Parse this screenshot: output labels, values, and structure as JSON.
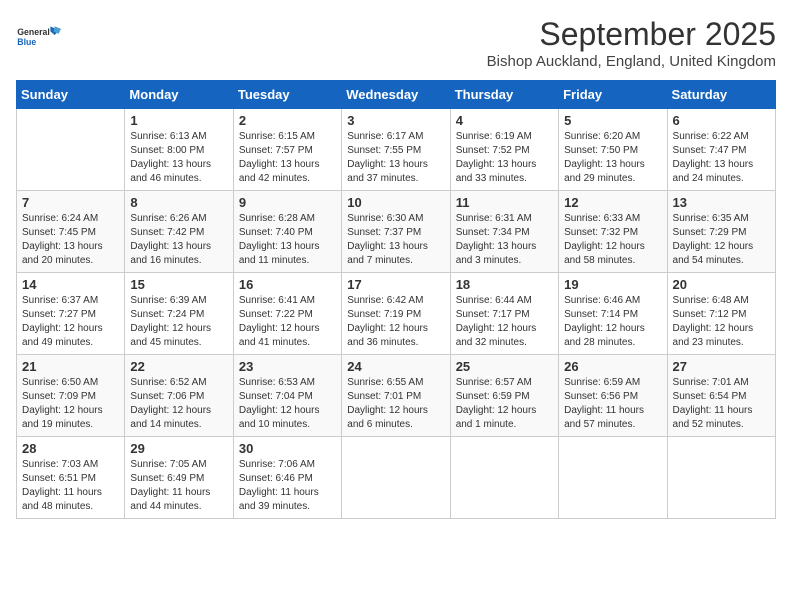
{
  "header": {
    "logo_general": "General",
    "logo_blue": "Blue",
    "month_title": "September 2025",
    "location": "Bishop Auckland, England, United Kingdom"
  },
  "calendar": {
    "days_of_week": [
      "Sunday",
      "Monday",
      "Tuesday",
      "Wednesday",
      "Thursday",
      "Friday",
      "Saturday"
    ],
    "weeks": [
      [
        {
          "day": "",
          "sunrise": "",
          "sunset": "",
          "daylight": ""
        },
        {
          "day": "1",
          "sunrise": "Sunrise: 6:13 AM",
          "sunset": "Sunset: 8:00 PM",
          "daylight": "Daylight: 13 hours and 46 minutes."
        },
        {
          "day": "2",
          "sunrise": "Sunrise: 6:15 AM",
          "sunset": "Sunset: 7:57 PM",
          "daylight": "Daylight: 13 hours and 42 minutes."
        },
        {
          "day": "3",
          "sunrise": "Sunrise: 6:17 AM",
          "sunset": "Sunset: 7:55 PM",
          "daylight": "Daylight: 13 hours and 37 minutes."
        },
        {
          "day": "4",
          "sunrise": "Sunrise: 6:19 AM",
          "sunset": "Sunset: 7:52 PM",
          "daylight": "Daylight: 13 hours and 33 minutes."
        },
        {
          "day": "5",
          "sunrise": "Sunrise: 6:20 AM",
          "sunset": "Sunset: 7:50 PM",
          "daylight": "Daylight: 13 hours and 29 minutes."
        },
        {
          "day": "6",
          "sunrise": "Sunrise: 6:22 AM",
          "sunset": "Sunset: 7:47 PM",
          "daylight": "Daylight: 13 hours and 24 minutes."
        }
      ],
      [
        {
          "day": "7",
          "sunrise": "Sunrise: 6:24 AM",
          "sunset": "Sunset: 7:45 PM",
          "daylight": "Daylight: 13 hours and 20 minutes."
        },
        {
          "day": "8",
          "sunrise": "Sunrise: 6:26 AM",
          "sunset": "Sunset: 7:42 PM",
          "daylight": "Daylight: 13 hours and 16 minutes."
        },
        {
          "day": "9",
          "sunrise": "Sunrise: 6:28 AM",
          "sunset": "Sunset: 7:40 PM",
          "daylight": "Daylight: 13 hours and 11 minutes."
        },
        {
          "day": "10",
          "sunrise": "Sunrise: 6:30 AM",
          "sunset": "Sunset: 7:37 PM",
          "daylight": "Daylight: 13 hours and 7 minutes."
        },
        {
          "day": "11",
          "sunrise": "Sunrise: 6:31 AM",
          "sunset": "Sunset: 7:34 PM",
          "daylight": "Daylight: 13 hours and 3 minutes."
        },
        {
          "day": "12",
          "sunrise": "Sunrise: 6:33 AM",
          "sunset": "Sunset: 7:32 PM",
          "daylight": "Daylight: 12 hours and 58 minutes."
        },
        {
          "day": "13",
          "sunrise": "Sunrise: 6:35 AM",
          "sunset": "Sunset: 7:29 PM",
          "daylight": "Daylight: 12 hours and 54 minutes."
        }
      ],
      [
        {
          "day": "14",
          "sunrise": "Sunrise: 6:37 AM",
          "sunset": "Sunset: 7:27 PM",
          "daylight": "Daylight: 12 hours and 49 minutes."
        },
        {
          "day": "15",
          "sunrise": "Sunrise: 6:39 AM",
          "sunset": "Sunset: 7:24 PM",
          "daylight": "Daylight: 12 hours and 45 minutes."
        },
        {
          "day": "16",
          "sunrise": "Sunrise: 6:41 AM",
          "sunset": "Sunset: 7:22 PM",
          "daylight": "Daylight: 12 hours and 41 minutes."
        },
        {
          "day": "17",
          "sunrise": "Sunrise: 6:42 AM",
          "sunset": "Sunset: 7:19 PM",
          "daylight": "Daylight: 12 hours and 36 minutes."
        },
        {
          "day": "18",
          "sunrise": "Sunrise: 6:44 AM",
          "sunset": "Sunset: 7:17 PM",
          "daylight": "Daylight: 12 hours and 32 minutes."
        },
        {
          "day": "19",
          "sunrise": "Sunrise: 6:46 AM",
          "sunset": "Sunset: 7:14 PM",
          "daylight": "Daylight: 12 hours and 28 minutes."
        },
        {
          "day": "20",
          "sunrise": "Sunrise: 6:48 AM",
          "sunset": "Sunset: 7:12 PM",
          "daylight": "Daylight: 12 hours and 23 minutes."
        }
      ],
      [
        {
          "day": "21",
          "sunrise": "Sunrise: 6:50 AM",
          "sunset": "Sunset: 7:09 PM",
          "daylight": "Daylight: 12 hours and 19 minutes."
        },
        {
          "day": "22",
          "sunrise": "Sunrise: 6:52 AM",
          "sunset": "Sunset: 7:06 PM",
          "daylight": "Daylight: 12 hours and 14 minutes."
        },
        {
          "day": "23",
          "sunrise": "Sunrise: 6:53 AM",
          "sunset": "Sunset: 7:04 PM",
          "daylight": "Daylight: 12 hours and 10 minutes."
        },
        {
          "day": "24",
          "sunrise": "Sunrise: 6:55 AM",
          "sunset": "Sunset: 7:01 PM",
          "daylight": "Daylight: 12 hours and 6 minutes."
        },
        {
          "day": "25",
          "sunrise": "Sunrise: 6:57 AM",
          "sunset": "Sunset: 6:59 PM",
          "daylight": "Daylight: 12 hours and 1 minute."
        },
        {
          "day": "26",
          "sunrise": "Sunrise: 6:59 AM",
          "sunset": "Sunset: 6:56 PM",
          "daylight": "Daylight: 11 hours and 57 minutes."
        },
        {
          "day": "27",
          "sunrise": "Sunrise: 7:01 AM",
          "sunset": "Sunset: 6:54 PM",
          "daylight": "Daylight: 11 hours and 52 minutes."
        }
      ],
      [
        {
          "day": "28",
          "sunrise": "Sunrise: 7:03 AM",
          "sunset": "Sunset: 6:51 PM",
          "daylight": "Daylight: 11 hours and 48 minutes."
        },
        {
          "day": "29",
          "sunrise": "Sunrise: 7:05 AM",
          "sunset": "Sunset: 6:49 PM",
          "daylight": "Daylight: 11 hours and 44 minutes."
        },
        {
          "day": "30",
          "sunrise": "Sunrise: 7:06 AM",
          "sunset": "Sunset: 6:46 PM",
          "daylight": "Daylight: 11 hours and 39 minutes."
        },
        {
          "day": "",
          "sunrise": "",
          "sunset": "",
          "daylight": ""
        },
        {
          "day": "",
          "sunrise": "",
          "sunset": "",
          "daylight": ""
        },
        {
          "day": "",
          "sunrise": "",
          "sunset": "",
          "daylight": ""
        },
        {
          "day": "",
          "sunrise": "",
          "sunset": "",
          "daylight": ""
        }
      ]
    ]
  }
}
